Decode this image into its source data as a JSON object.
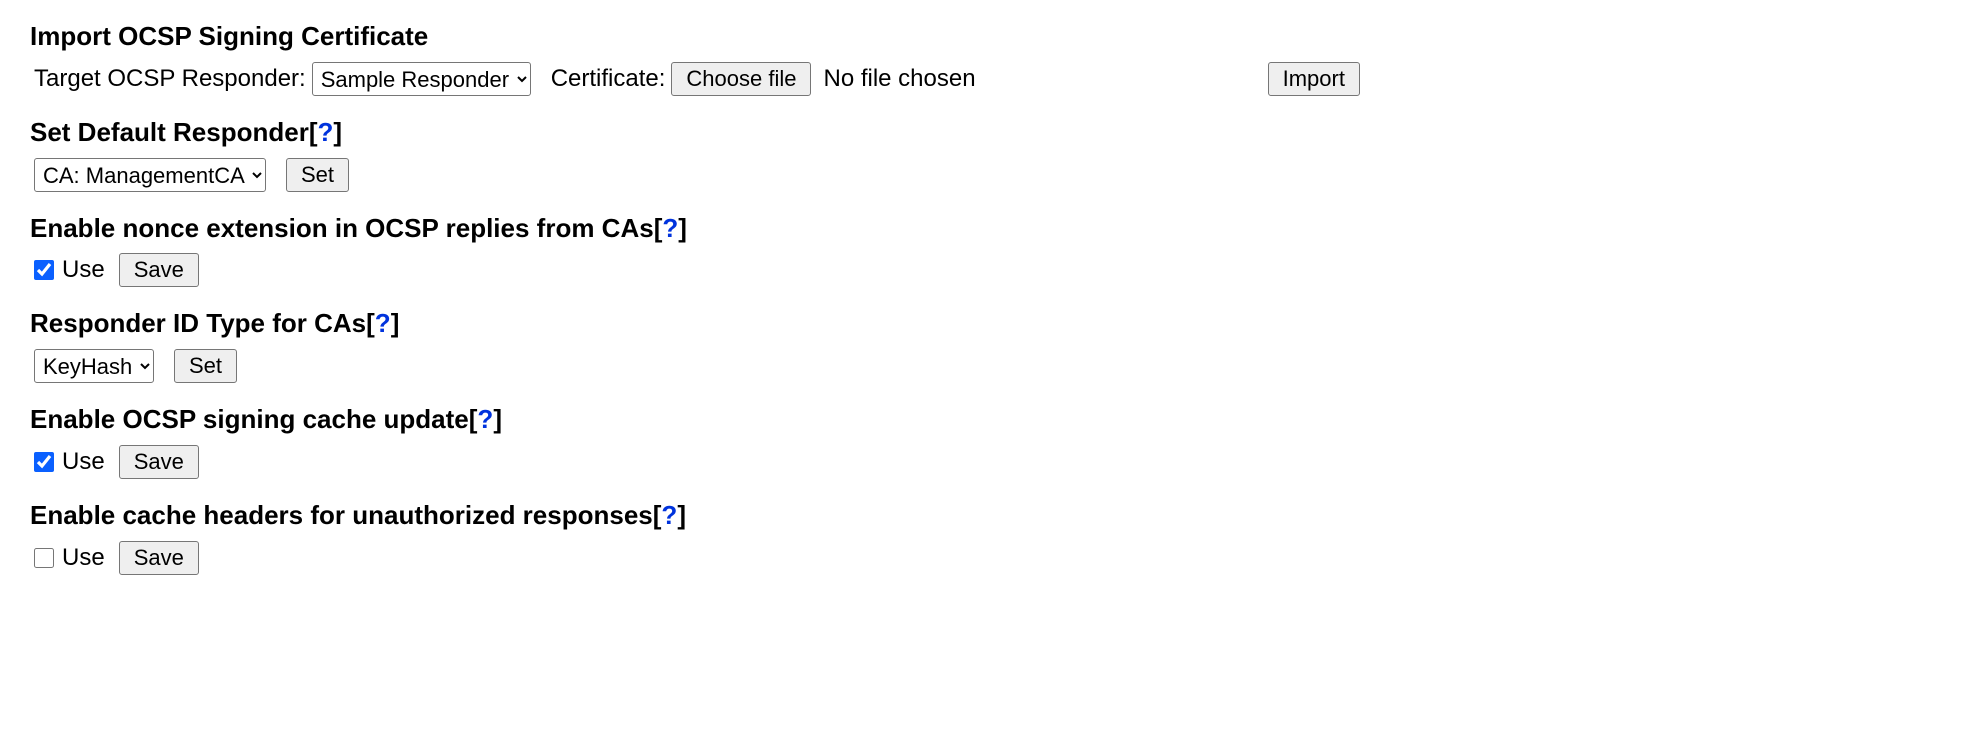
{
  "import_cert": {
    "heading": "Import OCSP Signing Certificate",
    "target_label": "Target OCSP Responder:",
    "responder_value": "Sample Responder",
    "certificate_label": "Certificate:",
    "choose_file_label": "Choose file",
    "file_status": "No file chosen",
    "import_button": "Import"
  },
  "default_responder": {
    "heading": "Set Default Responder",
    "help": "?",
    "select_value": "CA: ManagementCA",
    "set_button": "Set"
  },
  "nonce_extension": {
    "heading": "Enable nonce extension in OCSP replies from CAs",
    "help": "?",
    "use_label": "Use",
    "checked": true,
    "save_button": "Save"
  },
  "responder_id_type": {
    "heading": "Responder ID Type for CAs",
    "help": "?",
    "select_value": "KeyHash",
    "set_button": "Set"
  },
  "signing_cache": {
    "heading": "Enable OCSP signing cache update",
    "help": "?",
    "use_label": "Use",
    "checked": true,
    "save_button": "Save"
  },
  "cache_headers_unauth": {
    "heading": "Enable cache headers for unauthorized responses",
    "help": "?",
    "use_label": "Use",
    "checked": false,
    "save_button": "Save"
  }
}
